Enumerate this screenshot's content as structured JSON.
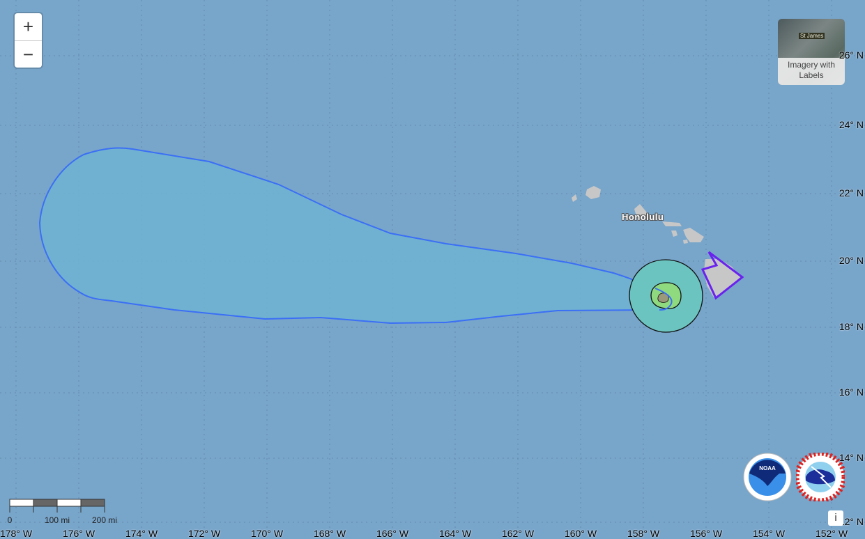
{
  "controls": {
    "zoom_in": "+",
    "zoom_out": "−",
    "info": "i"
  },
  "basemap": {
    "label": "Imagery with Labels",
    "thumb_text": "St James"
  },
  "place_labels": {
    "honolulu": "Honolulu"
  },
  "lat_labels": [
    "26° N",
    "24° N",
    "22° N",
    "20° N",
    "18° N",
    "16° N",
    "14° N",
    "12° N"
  ],
  "lon_labels": [
    "178° W",
    "176° W",
    "174° W",
    "172° W",
    "170° W",
    "168° W",
    "166° W",
    "164° W",
    "162° W",
    "160° W",
    "158° W",
    "156° W",
    "154° W",
    "152° W"
  ],
  "scale_bar": {
    "labels": [
      "0",
      "100 mi",
      "200 mi"
    ]
  },
  "logos": {
    "noaa": "NOAA",
    "nws": "National Weather Service"
  },
  "colors": {
    "ocean": "#78a5ca",
    "cone_fill": "#6fb3d2",
    "cone_stroke": "#3b6ff5",
    "wind_outer": "#6cc4c0",
    "wind_inner": "#8fd97f",
    "wind_core": "#9a9a7a",
    "warning": "#6a22ee",
    "land": "#c7c7c7"
  }
}
